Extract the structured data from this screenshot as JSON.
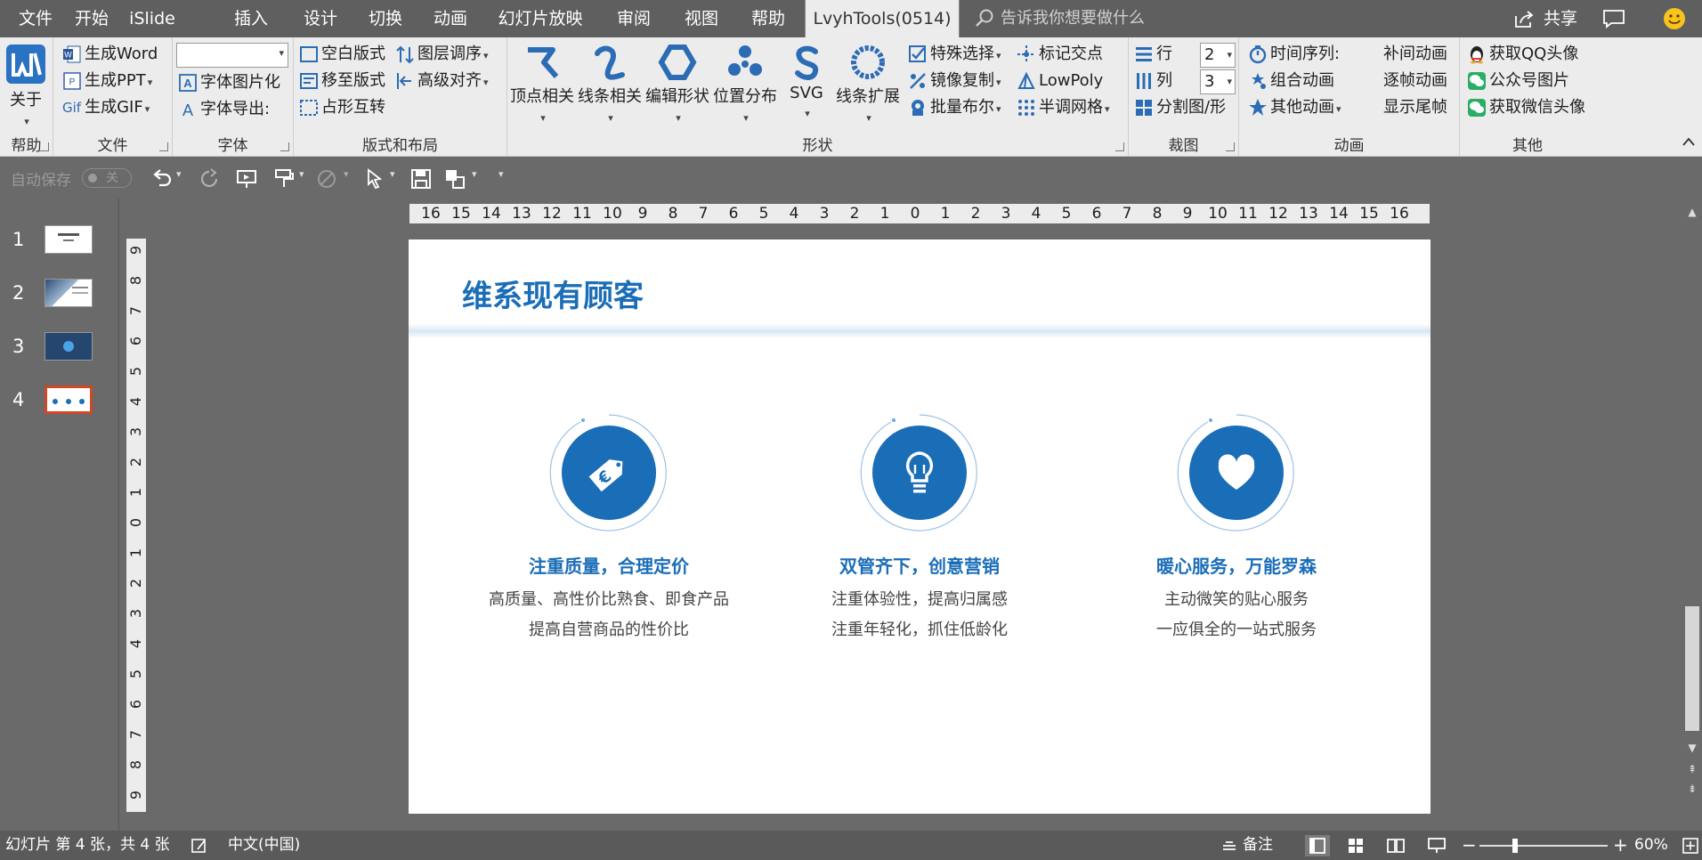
{
  "menubar": {
    "tabs": [
      "文件",
      "开始",
      "iSlide",
      "插入",
      "设计",
      "切换",
      "动画",
      "幻灯片放映",
      "审阅",
      "视图",
      "帮助",
      "LvyhTools(0514)"
    ],
    "active_tab": "LvyhTools(0514)",
    "tell_me_placeholder": "告诉我你想要做什么",
    "share_label": "共享"
  },
  "ribbon": {
    "groups": {
      "help": "帮助",
      "file": "文件",
      "font": "字体",
      "layout": "版式和布局",
      "shape": "形状",
      "crop": "裁图",
      "animation": "动画",
      "other": "其他"
    },
    "help": {
      "about": "关于"
    },
    "file": {
      "word": "生成Word",
      "ppt": "生成PPT",
      "gif": "生成GIF",
      "gif_badge": "Gif"
    },
    "font": {
      "combo_value": "",
      "font_image": "字体图片化",
      "font_export": "字体导出:"
    },
    "layout": {
      "blank_layout": "空白版式",
      "move_layout": "移至版式",
      "placeholder_swap": "占形互转",
      "layer_order": "图层调序",
      "adv_align": "高级对齐"
    },
    "shape": {
      "vertex": "顶点相关",
      "line": "线条相关",
      "edit_shape": "编辑形状",
      "distribute": "位置分布",
      "svg": "SVG",
      "line_extend": "线条扩展",
      "special_select": "特殊选择",
      "mirror_copy": "镜像复制",
      "batch_boolean": "批量布尔",
      "mark_intersect": "标记交点",
      "lowpoly": "LowPoly",
      "halftone": "半调网格"
    },
    "crop": {
      "row": "行",
      "col": "列",
      "row_value": "2",
      "col_value": "3",
      "split": "分割图/形"
    },
    "animation": {
      "timeline": "时间序列:",
      "combo_anim": "组合动画",
      "other_anim": "其他动画",
      "tween": "补间动画",
      "frame": "逐帧动画",
      "show_tail": "显示尾帧"
    },
    "other": {
      "qq_avatar": "获取QQ头像",
      "wechat_image": "公众号图片",
      "wechat_avatar": "获取微信头像"
    }
  },
  "qat": {
    "autosave": "自动保存",
    "toggle": "关"
  },
  "thumbnails": [
    "1",
    "2",
    "3",
    "4"
  ],
  "selected_slide": "4",
  "hruler": [
    "16",
    "15",
    "14",
    "13",
    "12",
    "11",
    "10",
    "9",
    "8",
    "7",
    "6",
    "5",
    "4",
    "3",
    "2",
    "1",
    "0",
    "1",
    "2",
    "3",
    "4",
    "5",
    "6",
    "7",
    "8",
    "9",
    "10",
    "11",
    "12",
    "13",
    "14",
    "15",
    "16"
  ],
  "vruler": [
    "9",
    "8",
    "7",
    "6",
    "5",
    "4",
    "3",
    "2",
    "1",
    "0",
    "1",
    "2",
    "3",
    "4",
    "5",
    "6",
    "7",
    "8",
    "9"
  ],
  "slide": {
    "title": "维系现有顾客",
    "accent_color": "#1a6db7",
    "features": [
      {
        "icon": "euro-tag-icon",
        "title": "注重质量，合理定价",
        "line1": "高质量、高性价比熟食、即食产品",
        "line2": "提高自营商品的性价比"
      },
      {
        "icon": "lightbulb-icon",
        "title": "双管齐下，创意营销",
        "line1": "注重体验性，提高归属感",
        "line2": "注重年轻化，抓住低龄化"
      },
      {
        "icon": "heart-icon",
        "title": "暖心服务，万能罗森",
        "line1": "主动微笑的贴心服务",
        "line2": "一应俱全的一站式服务"
      }
    ]
  },
  "status": {
    "slide_info": "幻灯片 第 4 张，共 4 张",
    "language": "中文(中国)",
    "notes": "备注",
    "zoom": "60%",
    "zoom_level_percent": 60
  }
}
